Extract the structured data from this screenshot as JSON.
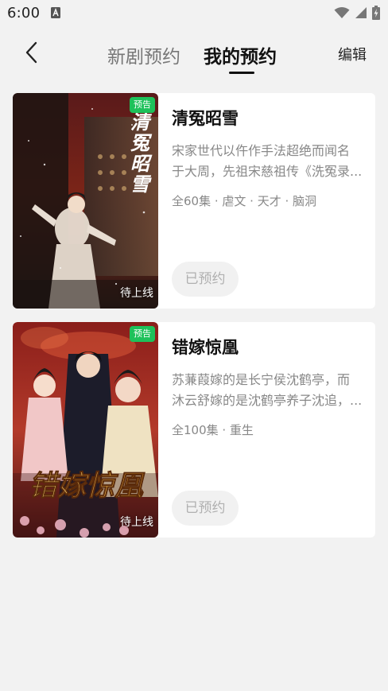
{
  "status_bar": {
    "time": "6:00",
    "icons": [
      "notification-a-icon",
      "wifi-icon",
      "signal-icon",
      "battery-charging-icon"
    ]
  },
  "header": {
    "tabs": [
      {
        "label": "新剧预约",
        "active": false
      },
      {
        "label": "我的预约",
        "active": true
      }
    ],
    "edit_label": "编辑",
    "back_icon": "chevron-left-icon"
  },
  "cards": [
    {
      "tag": "预告",
      "poster_status": "待上线",
      "poster_text": "清冤昭雪",
      "title": "清冤昭雪",
      "description_lines": [
        "宋家世代以仵作手法超绝而闻名",
        "于大周，先祖宋慈祖传《洗冤录..."
      ],
      "meta": "全60集 · 虐文 · 天才 · 脑洞",
      "reserve_label": "已预约"
    },
    {
      "tag": "预告",
      "poster_status": "待上线",
      "poster_text": "错嫁惊凰",
      "title": "错嫁惊凰",
      "description_lines": [
        "苏蒹葭嫁的是长宁侯沈鹤亭，而",
        "沐云舒嫁的是沈鹤亭养子沈追，..."
      ],
      "meta": "全100集 · 重生",
      "reserve_label": "已预约"
    }
  ],
  "colors": {
    "background": "#f2f2f2",
    "tag_green": "#1ec15a",
    "reserve_button_bg": "#f1f1f1",
    "reserve_button_text": "#b0b0b0"
  }
}
